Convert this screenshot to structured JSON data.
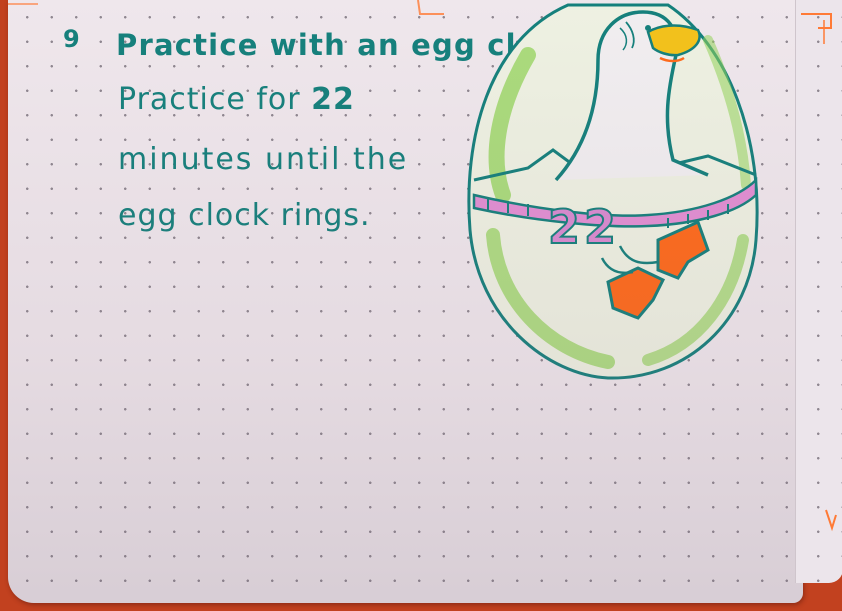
{
  "item": {
    "number": "9",
    "title": "Practice with an egg clock"
  },
  "body": {
    "line1_prefix": "Practice for ",
    "minutes": "22",
    "line2": "minutes until the",
    "line3": "egg clock rings."
  },
  "illustration": {
    "timer_number": "22"
  },
  "colors": {
    "ink": "#15807c",
    "egg_green": "#8fd24c",
    "egg_shell": "#efe8ed",
    "beak": "#f1c21b",
    "feet": "#ff6a1a",
    "timer_band": "#d86fc4",
    "paper_edge": "#c2411f"
  }
}
